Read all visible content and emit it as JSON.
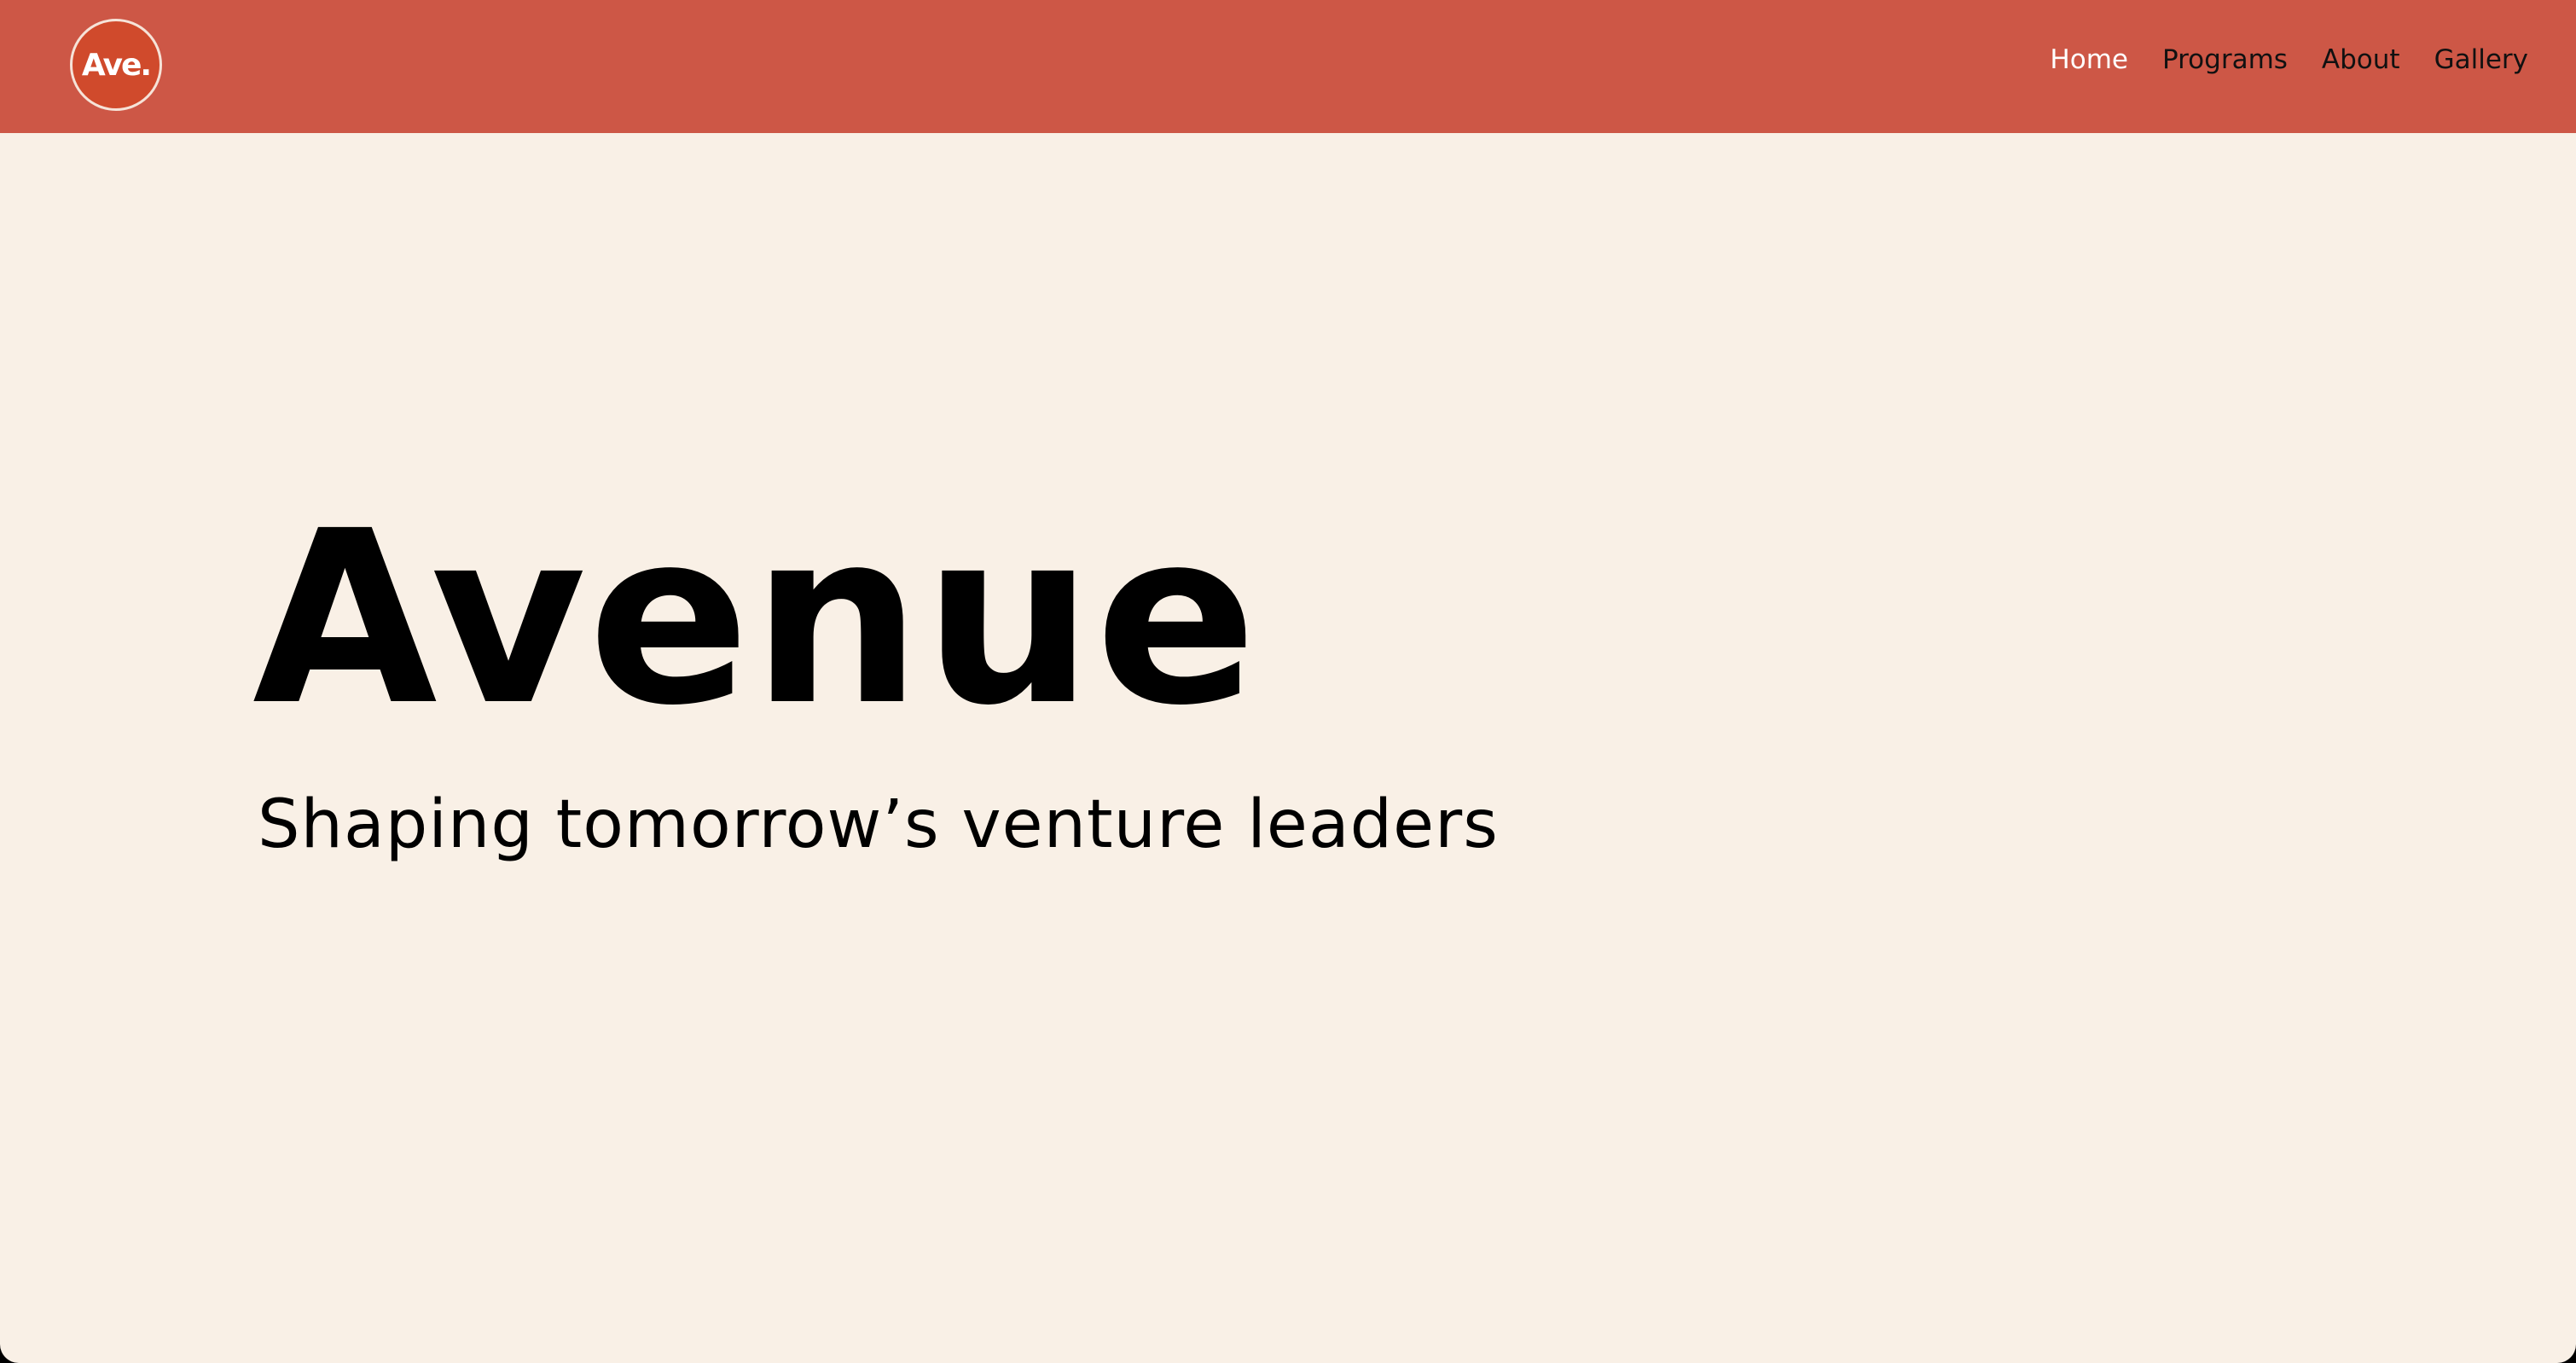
{
  "brand": {
    "logo_text": "Ave.",
    "colors": {
      "header": "#CD5746",
      "logo_fill": "#D04A2C",
      "background": "#F9F0E6",
      "active_link": "#FFFFFF",
      "text": "#000000"
    }
  },
  "nav": {
    "items": [
      {
        "label": "Home",
        "active": true
      },
      {
        "label": "Programs",
        "active": false
      },
      {
        "label": "About",
        "active": false
      },
      {
        "label": "Gallery",
        "active": false
      }
    ]
  },
  "hero": {
    "title": "Avenue",
    "subtitle": "Shaping tomorrow’s venture leaders"
  }
}
